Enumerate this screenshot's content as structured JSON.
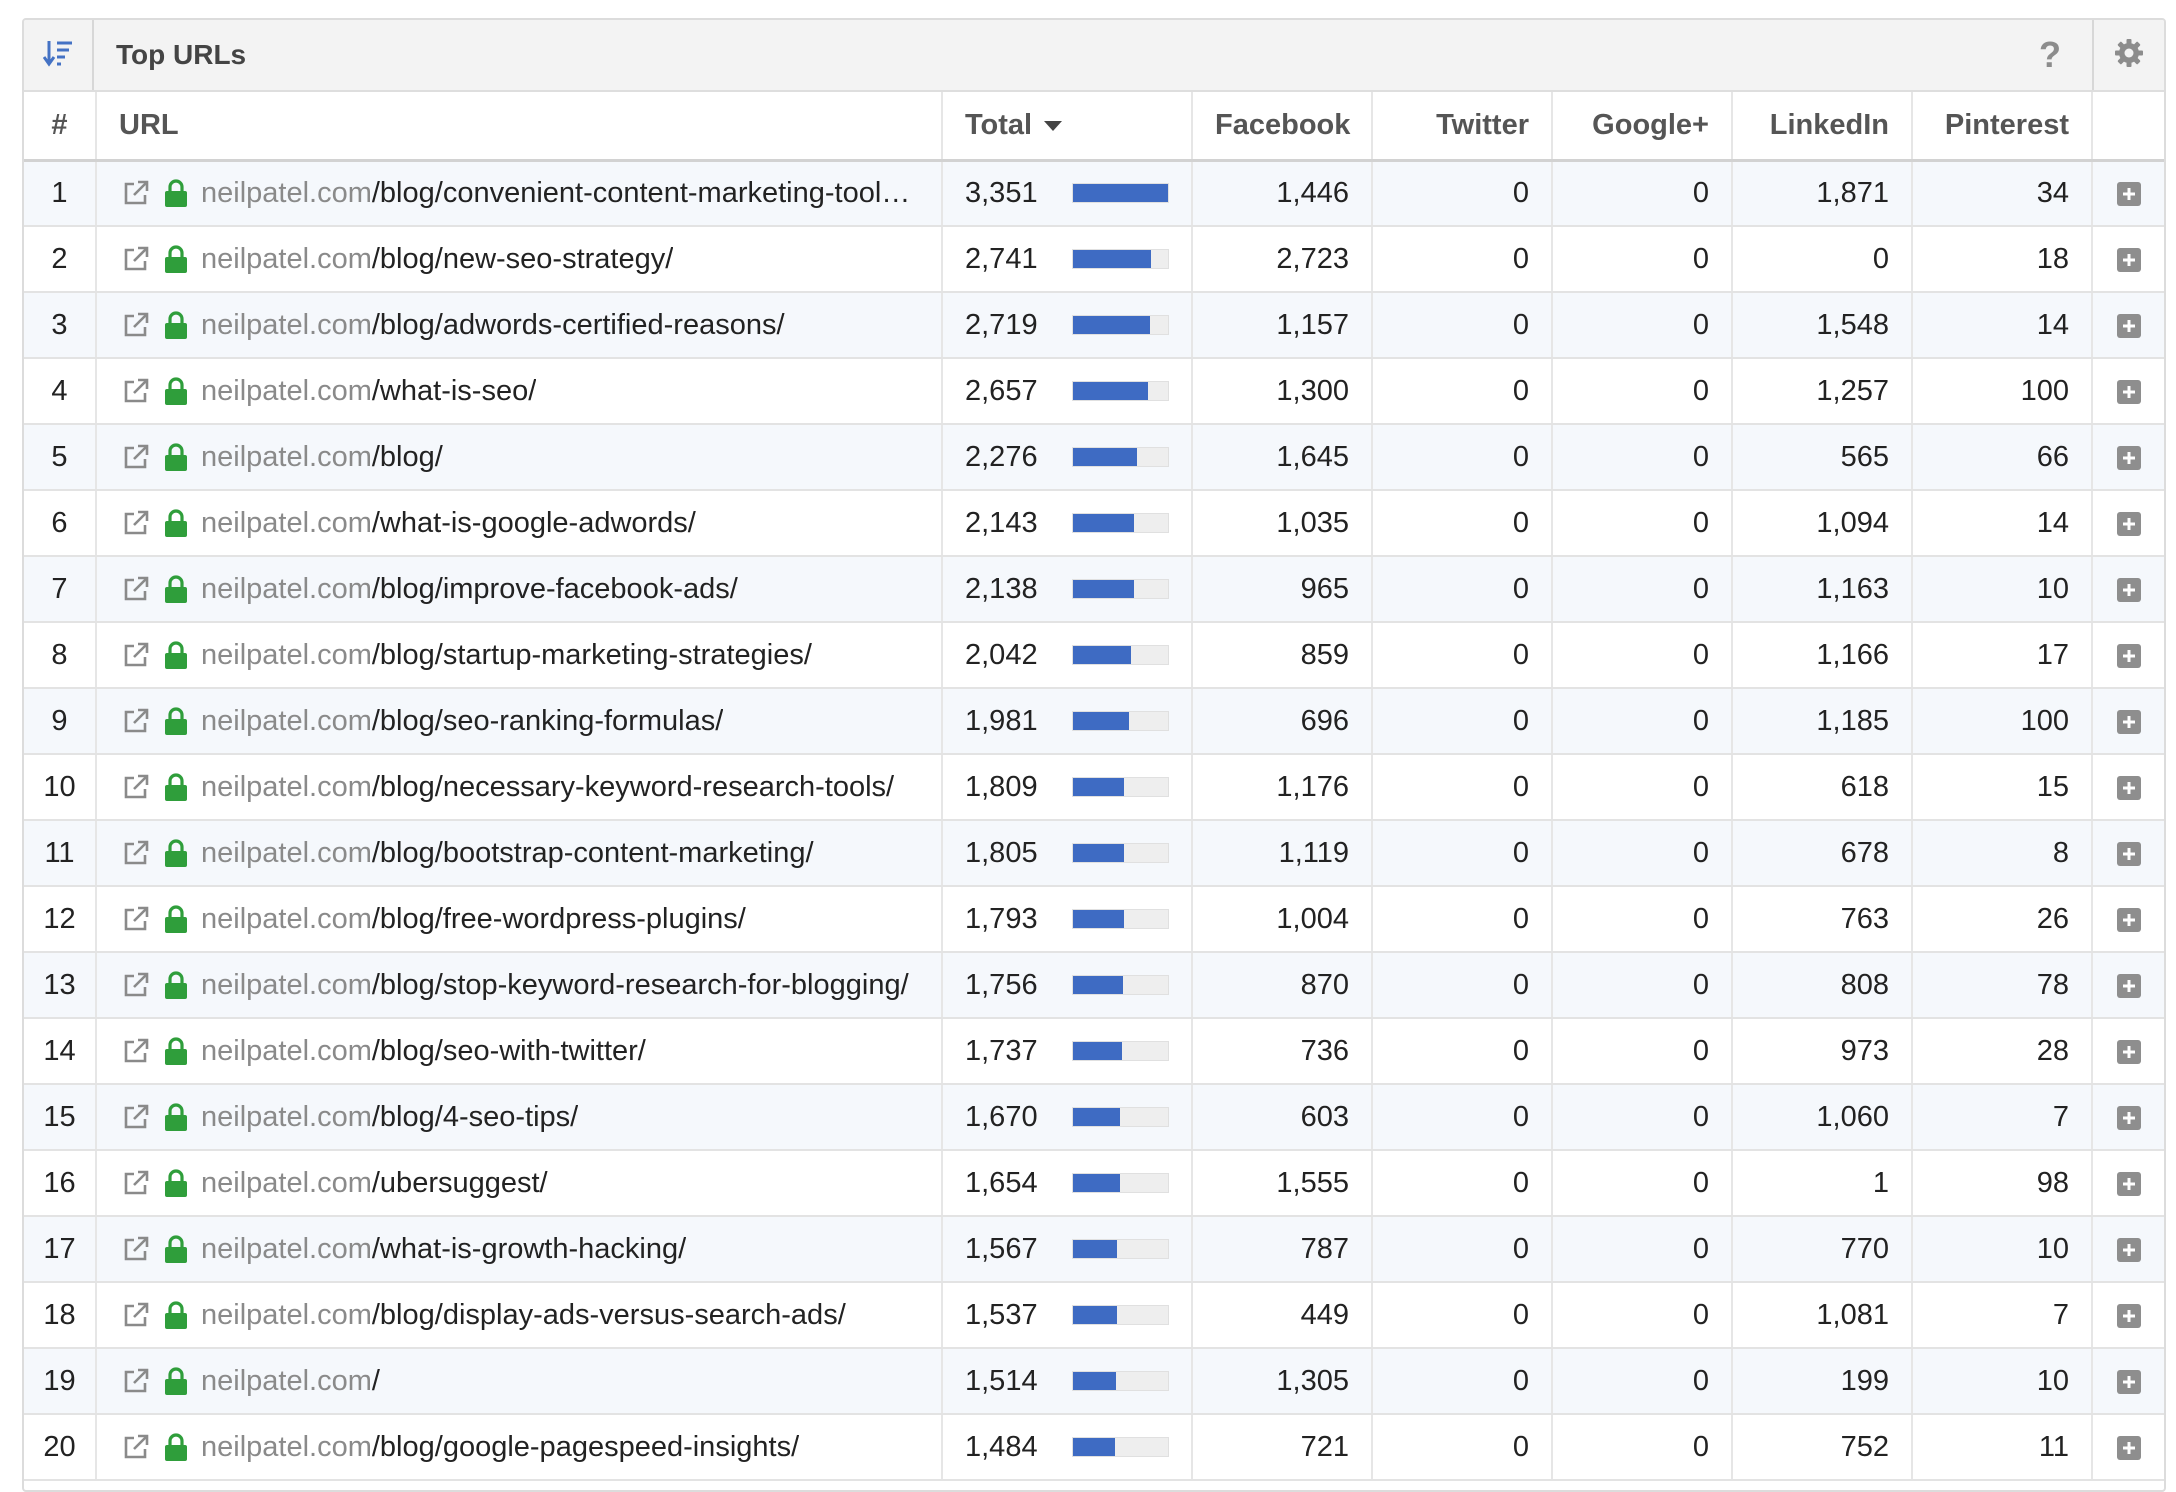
{
  "header": {
    "title": "Top URLs",
    "help_label": "?"
  },
  "columns": {
    "num": "#",
    "url": "URL",
    "total": "Total",
    "facebook": "Facebook",
    "twitter": "Twitter",
    "googleplus": "Google+",
    "linkedin": "LinkedIn",
    "pinterest": "Pinterest"
  },
  "colors": {
    "bar": "#3e6bc3",
    "lock": "#2f9e3b",
    "sort_icon": "#4472c4"
  },
  "icons": [
    "sort-icon",
    "help-icon",
    "gear-icon",
    "external-link-icon",
    "lock-icon",
    "expand-plus-icon",
    "sort-desc-caret-icon"
  ],
  "rows": [
    {
      "num": "1",
      "domain": "neilpatel.com",
      "path": "/blog/convenient-content-marketing-tools/ ...",
      "total": "3,351",
      "bar_fraction": 1.0,
      "facebook": "1,446",
      "twitter": "0",
      "googleplus": "0",
      "linkedin": "1,871",
      "pinterest": "34"
    },
    {
      "num": "2",
      "domain": "neilpatel.com",
      "path": "/blog/new-seo-strategy/",
      "total": "2,741",
      "bar_fraction": 0.818,
      "facebook": "2,723",
      "twitter": "0",
      "googleplus": "0",
      "linkedin": "0",
      "pinterest": "18"
    },
    {
      "num": "3",
      "domain": "neilpatel.com",
      "path": "/blog/adwords-certified-reasons/",
      "total": "2,719",
      "bar_fraction": 0.811,
      "facebook": "1,157",
      "twitter": "0",
      "googleplus": "0",
      "linkedin": "1,548",
      "pinterest": "14"
    },
    {
      "num": "4",
      "domain": "neilpatel.com",
      "path": "/what-is-seo/",
      "total": "2,657",
      "bar_fraction": 0.793,
      "facebook": "1,300",
      "twitter": "0",
      "googleplus": "0",
      "linkedin": "1,257",
      "pinterest": "100"
    },
    {
      "num": "5",
      "domain": "neilpatel.com",
      "path": "/blog/",
      "total": "2,276",
      "bar_fraction": 0.679,
      "facebook": "1,645",
      "twitter": "0",
      "googleplus": "0",
      "linkedin": "565",
      "pinterest": "66"
    },
    {
      "num": "6",
      "domain": "neilpatel.com",
      "path": "/what-is-google-adwords/",
      "total": "2,143",
      "bar_fraction": 0.64,
      "facebook": "1,035",
      "twitter": "0",
      "googleplus": "0",
      "linkedin": "1,094",
      "pinterest": "14"
    },
    {
      "num": "7",
      "domain": "neilpatel.com",
      "path": "/blog/improve-facebook-ads/",
      "total": "2,138",
      "bar_fraction": 0.638,
      "facebook": "965",
      "twitter": "0",
      "googleplus": "0",
      "linkedin": "1,163",
      "pinterest": "10"
    },
    {
      "num": "8",
      "domain": "neilpatel.com",
      "path": "/blog/startup-marketing-strategies/",
      "total": "2,042",
      "bar_fraction": 0.609,
      "facebook": "859",
      "twitter": "0",
      "googleplus": "0",
      "linkedin": "1,166",
      "pinterest": "17"
    },
    {
      "num": "9",
      "domain": "neilpatel.com",
      "path": "/blog/seo-ranking-formulas/",
      "total": "1,981",
      "bar_fraction": 0.591,
      "facebook": "696",
      "twitter": "0",
      "googleplus": "0",
      "linkedin": "1,185",
      "pinterest": "100"
    },
    {
      "num": "10",
      "domain": "neilpatel.com",
      "path": "/blog/necessary-keyword-research-tools/",
      "total": "1,809",
      "bar_fraction": 0.54,
      "facebook": "1,176",
      "twitter": "0",
      "googleplus": "0",
      "linkedin": "618",
      "pinterest": "15"
    },
    {
      "num": "11",
      "domain": "neilpatel.com",
      "path": "/blog/bootstrap-content-marketing/",
      "total": "1,805",
      "bar_fraction": 0.539,
      "facebook": "1,119",
      "twitter": "0",
      "googleplus": "0",
      "linkedin": "678",
      "pinterest": "8"
    },
    {
      "num": "12",
      "domain": "neilpatel.com",
      "path": "/blog/free-wordpress-plugins/",
      "total": "1,793",
      "bar_fraction": 0.535,
      "facebook": "1,004",
      "twitter": "0",
      "googleplus": "0",
      "linkedin": "763",
      "pinterest": "26"
    },
    {
      "num": "13",
      "domain": "neilpatel.com",
      "path": "/blog/stop-keyword-research-for-blogging/",
      "total": "1,756",
      "bar_fraction": 0.524,
      "facebook": "870",
      "twitter": "0",
      "googleplus": "0",
      "linkedin": "808",
      "pinterest": "78"
    },
    {
      "num": "14",
      "domain": "neilpatel.com",
      "path": "/blog/seo-with-twitter/",
      "total": "1,737",
      "bar_fraction": 0.518,
      "facebook": "736",
      "twitter": "0",
      "googleplus": "0",
      "linkedin": "973",
      "pinterest": "28"
    },
    {
      "num": "15",
      "domain": "neilpatel.com",
      "path": "/blog/4-seo-tips/",
      "total": "1,670",
      "bar_fraction": 0.498,
      "facebook": "603",
      "twitter": "0",
      "googleplus": "0",
      "linkedin": "1,060",
      "pinterest": "7"
    },
    {
      "num": "16",
      "domain": "neilpatel.com",
      "path": "/ubersuggest/",
      "total": "1,654",
      "bar_fraction": 0.494,
      "facebook": "1,555",
      "twitter": "0",
      "googleplus": "0",
      "linkedin": "1",
      "pinterest": "98"
    },
    {
      "num": "17",
      "domain": "neilpatel.com",
      "path": "/what-is-growth-hacking/",
      "total": "1,567",
      "bar_fraction": 0.468,
      "facebook": "787",
      "twitter": "0",
      "googleplus": "0",
      "linkedin": "770",
      "pinterest": "10"
    },
    {
      "num": "18",
      "domain": "neilpatel.com",
      "path": "/blog/display-ads-versus-search-ads/",
      "total": "1,537",
      "bar_fraction": 0.459,
      "facebook": "449",
      "twitter": "0",
      "googleplus": "0",
      "linkedin": "1,081",
      "pinterest": "7"
    },
    {
      "num": "19",
      "domain": "neilpatel.com",
      "path": "/",
      "total": "1,514",
      "bar_fraction": 0.452,
      "facebook": "1,305",
      "twitter": "0",
      "googleplus": "0",
      "linkedin": "199",
      "pinterest": "10"
    },
    {
      "num": "20",
      "domain": "neilpatel.com",
      "path": "/blog/google-pagespeed-insights/",
      "total": "1,484",
      "bar_fraction": 0.443,
      "facebook": "721",
      "twitter": "0",
      "googleplus": "0",
      "linkedin": "752",
      "pinterest": "11"
    }
  ]
}
